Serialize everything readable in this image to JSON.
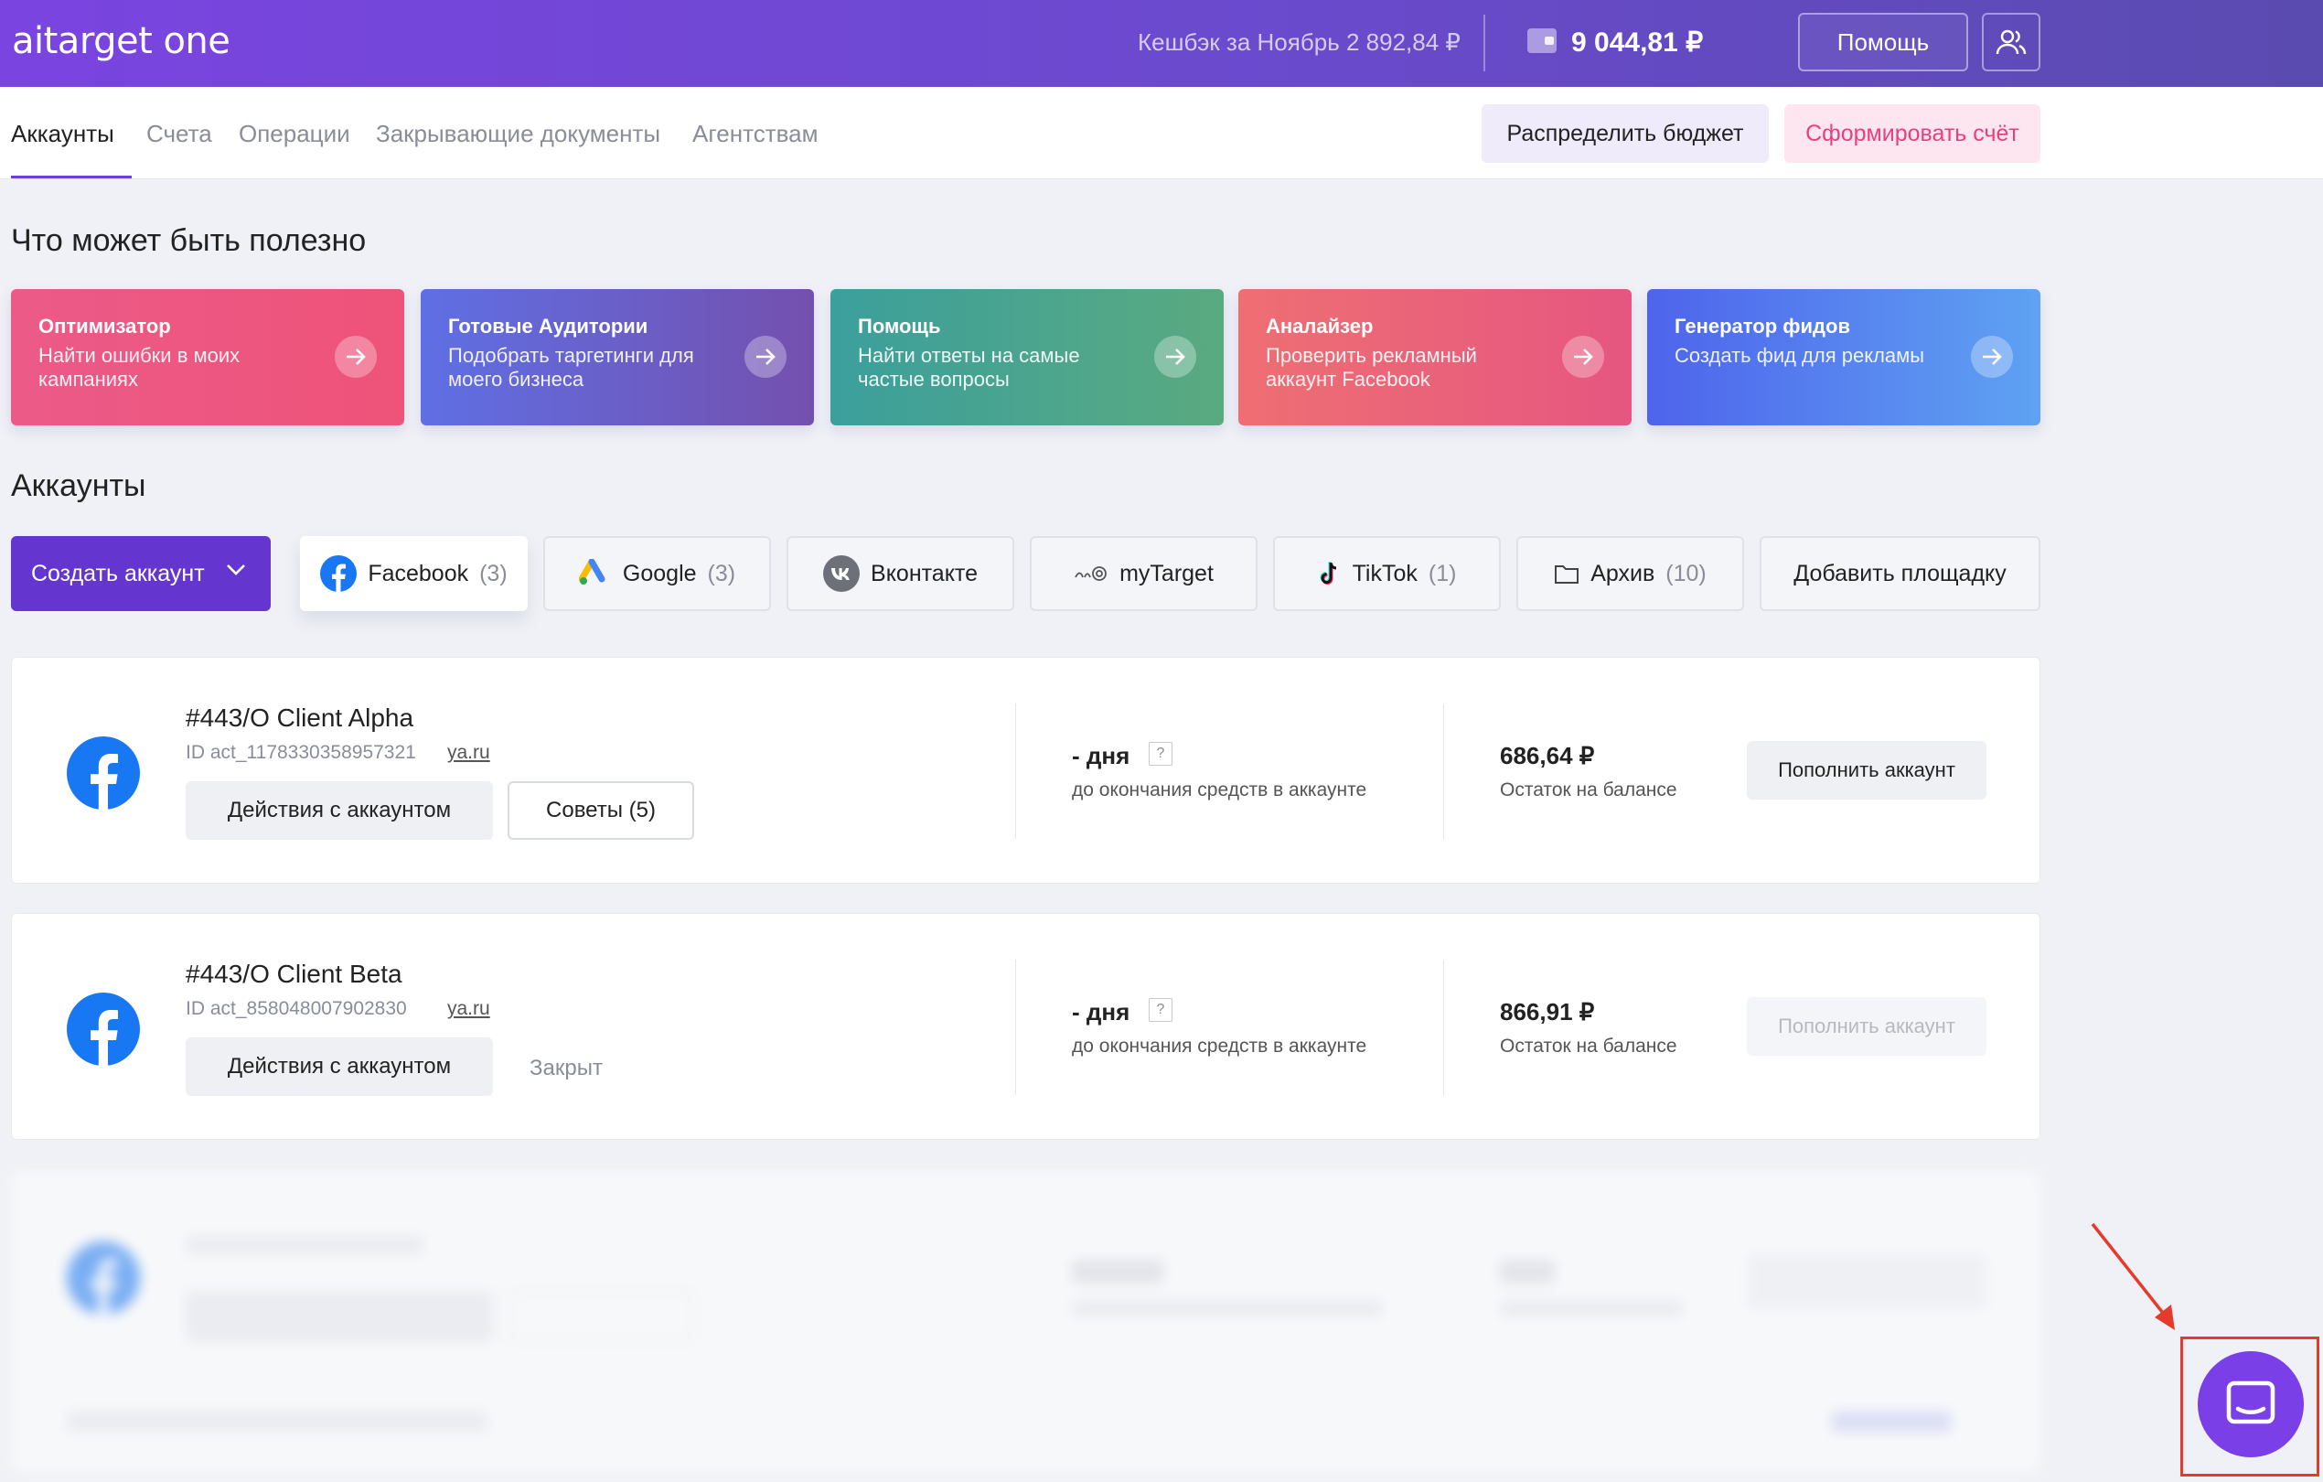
{
  "header": {
    "logo": "aitarget one",
    "cashback": "Кешбэк за Ноябрь 2 892,84 ₽",
    "balance": "9 044,81 ₽",
    "help_label": "Помощь"
  },
  "nav": {
    "tabs": [
      "Аккаунты",
      "Счета",
      "Операции",
      "Закрывающие документы",
      "Агентствам"
    ],
    "active_tab": "Аккаунты",
    "distribute_label": "Распределить бюджет",
    "invoice_label": "Сформировать счёт"
  },
  "useful": {
    "heading": "Что может быть полезно",
    "cards": [
      {
        "title": "Оптимизатор",
        "text": "Найти ошибки в моих кампаниях"
      },
      {
        "title": "Готовые Аудитории",
        "text": "Подобрать таргетинги для моего бизнеса"
      },
      {
        "title": "Помощь",
        "text": "Найти ответы на самые частые вопросы"
      },
      {
        "title": "Аналайзер",
        "text": "Проверить рекламный аккаунт Facebook"
      },
      {
        "title": "Генератор фидов",
        "text": "Создать фид для рекламы"
      }
    ]
  },
  "accounts": {
    "heading": "Аккаунты",
    "create_label": "Создать аккаунт",
    "platforms": [
      {
        "name": "Facebook",
        "count": "(3)",
        "icon": "facebook-icon"
      },
      {
        "name": "Google",
        "count": "(3)",
        "icon": "google-ads-icon"
      },
      {
        "name": "Вконтакте",
        "count": "",
        "icon": "vk-icon"
      },
      {
        "name": "myTarget",
        "count": "",
        "icon": "mytarget-icon"
      },
      {
        "name": "TikTok",
        "count": "(1)",
        "icon": "tiktok-icon"
      },
      {
        "name": "Архив",
        "count": "(10)",
        "icon": "folder-icon"
      }
    ],
    "add_platform_label": "Добавить площадку",
    "items": [
      {
        "name": "#443/O Client Alpha",
        "id": "ID act_1178330358957321",
        "site": "ya.ru",
        "actions_label": "Действия с аккаунтом",
        "tips_label": "Советы (5)",
        "days": "- дня",
        "days_sub": "до окончания средств в аккаунте",
        "amount": "686,64 ₽",
        "amount_sub": "Остаток на балансе",
        "topup_label": "Пополнить аккаунт"
      },
      {
        "name": "#443/O Client Beta",
        "id": "ID act_858048007902830",
        "site": "ya.ru",
        "actions_label": "Действия с аккаунтом",
        "status": "Закрыт",
        "days": "- дня",
        "days_sub": "до окончания средств в аккаунте",
        "amount": "866,91 ₽",
        "amount_sub": "Остаток на балансе",
        "topup_label": "Пополнить аккаунт"
      }
    ],
    "question_mark": "?"
  },
  "colors": {
    "header_gradient_start": "#7a44e0",
    "accent": "#6535d0",
    "facebook": "#1877f2",
    "invoice_text": "#e5407f",
    "chat_button": "#7a3fe6",
    "annotation_red": "#e53b2e"
  }
}
